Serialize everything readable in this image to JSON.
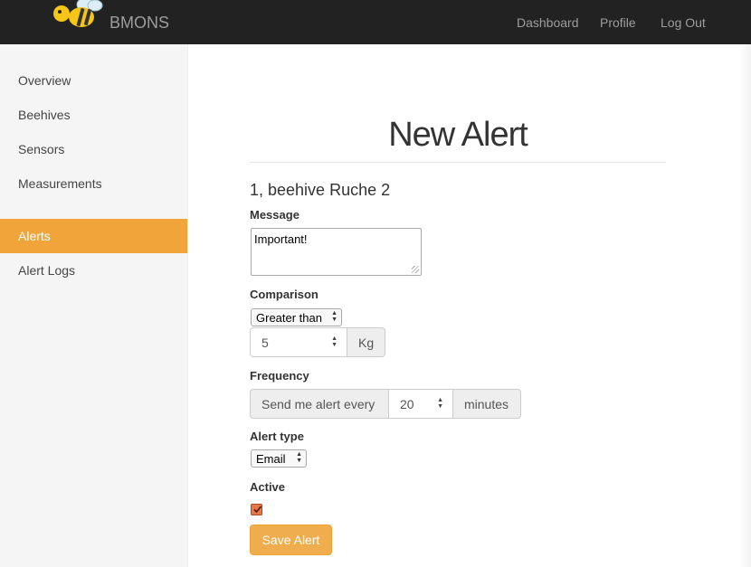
{
  "navbar": {
    "logo_icon": "bee-icon",
    "brand": "BMONS",
    "links": [
      "Dashboard",
      "Profile",
      "Log Out"
    ]
  },
  "sidebar": {
    "items": [
      {
        "label": "Overview",
        "active": false
      },
      {
        "label": "Beehives",
        "active": false
      },
      {
        "label": "Sensors",
        "active": false
      },
      {
        "label": "Measurements",
        "active": false
      },
      {
        "label": "Alerts",
        "active": true
      },
      {
        "label": "Alert Logs",
        "active": false
      }
    ]
  },
  "main": {
    "title": "New Alert",
    "subtitle": "1, beehive Ruche 2",
    "message": {
      "label": "Message",
      "value": "Important!"
    },
    "comparison": {
      "label": "Comparison",
      "operator": "Greater than",
      "value": "5",
      "unit": "Kg"
    },
    "frequency": {
      "label": "Frequency",
      "prefix": "Send me alert every",
      "value": "20",
      "suffix": "minutes"
    },
    "alert_type": {
      "label": "Alert type",
      "value": "Email"
    },
    "active": {
      "label": "Active",
      "checked": true
    },
    "save_label": "Save Alert"
  },
  "colors": {
    "navbar_bg": "#222222",
    "accent": "#f0a43a",
    "button": "#f0ad4e"
  }
}
